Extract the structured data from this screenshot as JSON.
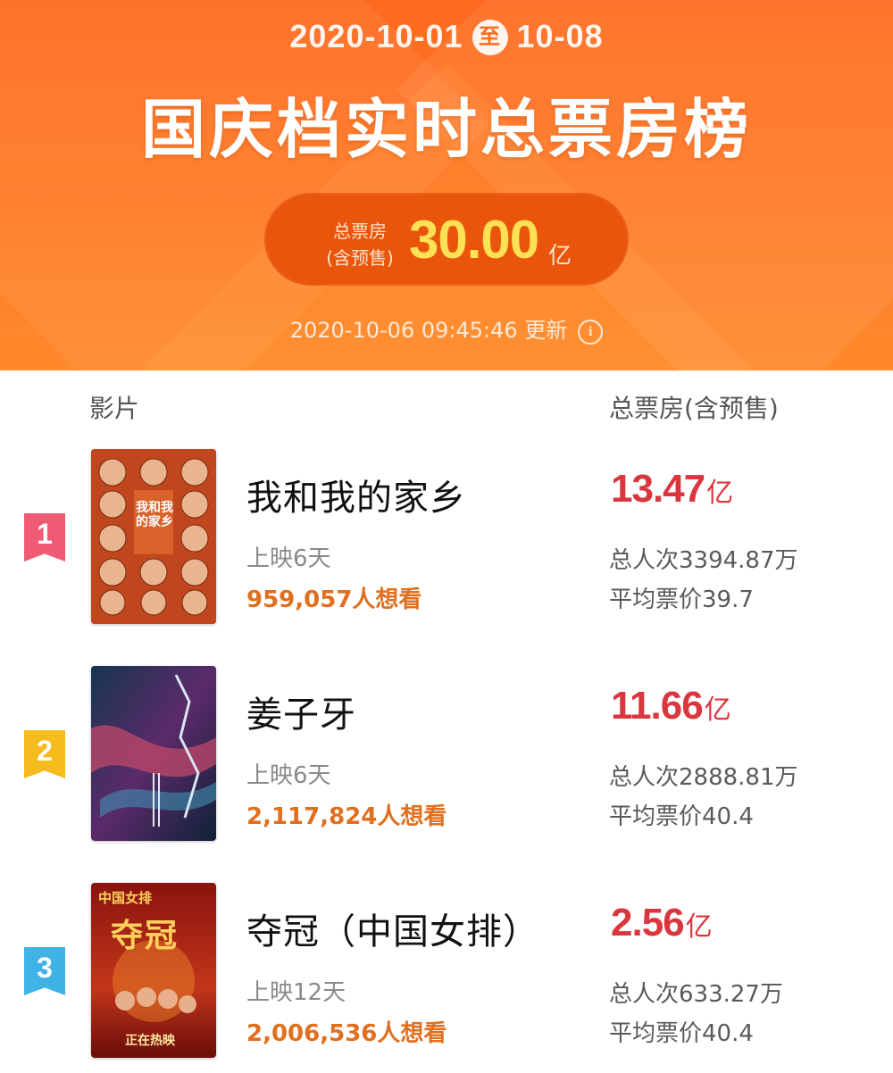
{
  "header": {
    "date_start": "2020-10-01",
    "date_sep": "至",
    "date_end": "10-08",
    "title": "国庆档实时总票房榜",
    "total_label_1": "总票房",
    "total_label_2": "(含预售)",
    "total_value": "30.00",
    "total_unit": "亿",
    "update_time": "2020-10-06 09:45:46 更新",
    "info_icon": "info-icon"
  },
  "columns": {
    "film": "影片",
    "box_office": "总票房(含预售)"
  },
  "films": [
    {
      "rank": "1",
      "rank_color": "#ef5b74",
      "name": "我和我的家乡",
      "days": "上映6天",
      "want": "959,057人想看",
      "box_value": "13.47",
      "box_unit": "亿",
      "admissions": "总人次3394.87万",
      "avg_price": "平均票价39.7",
      "poster_text": "我和我的家乡",
      "poster_bg": "#b83a1f"
    },
    {
      "rank": "2",
      "rank_color": "#f6bb1d",
      "name": "姜子牙",
      "days": "上映6天",
      "want": "2,117,824人想看",
      "box_value": "11.66",
      "box_unit": "亿",
      "admissions": "总人次2888.81万",
      "avg_price": "平均票价40.4",
      "poster_bg": "#1e3a52"
    },
    {
      "rank": "3",
      "rank_color": "#3fb3e6",
      "name": "夺冠（中国女排）",
      "days": "上映12天",
      "want": "2,006,536人想看",
      "box_value": "2.56",
      "box_unit": "亿",
      "admissions": "总人次633.27万",
      "avg_price": "平均票价40.4",
      "poster_text_top": "中国女排",
      "poster_text_main": "夺冠",
      "poster_text_bottom": "正在热映",
      "poster_bg": "#9b1a12"
    }
  ]
}
